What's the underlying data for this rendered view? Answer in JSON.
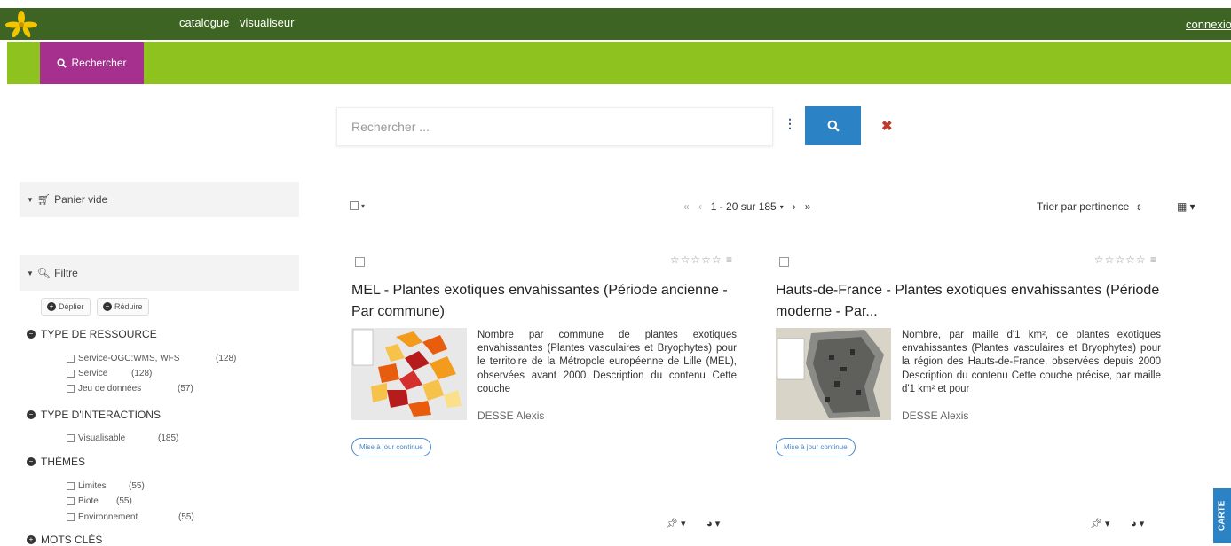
{
  "nav": {
    "items": [
      "catalogue",
      "visualiseur"
    ],
    "connexion": "connexion"
  },
  "subnav": {
    "rechercher": "Rechercher"
  },
  "search": {
    "placeholder": "Rechercher ..."
  },
  "sidebar": {
    "panier": "Panier vide",
    "filtre": "Filtre",
    "deplier": "Déplier",
    "reduire": "Réduire",
    "facets": [
      {
        "title": "TYPE DE RESSOURCE",
        "items": [
          {
            "label": "Service-OGC:WMS, WFS",
            "count": "(128)"
          },
          {
            "label": "Service",
            "count": "(128)"
          },
          {
            "label": "Jeu de données",
            "count": "(57)"
          }
        ]
      },
      {
        "title": "TYPE D'INTERACTIONS",
        "items": [
          {
            "label": "Visualisable",
            "count": "(185)"
          }
        ]
      },
      {
        "title": "THÈMES",
        "items": [
          {
            "label": "Limites",
            "count": "(55)"
          },
          {
            "label": "Biote",
            "count": "(55)"
          },
          {
            "label": "Environnement",
            "count": "(55)"
          }
        ]
      },
      {
        "title": "MOTS CLÉS",
        "items": []
      }
    ]
  },
  "results": {
    "pager_text": "1 - 20 sur 185",
    "sort_label": "Trier par pertinence",
    "cards": [
      {
        "title": "MEL - Plantes exotiques envahissantes (Période ancienne - Par commune)",
        "description": "Nombre par commune de plantes exotiques envahissantes (Plantes vasculaires et Bryophytes) pour le territoire de la Métropole européenne de Lille (MEL), observées avant 2000 Description du contenu Cette couche",
        "author": "DESSE Alexis",
        "badge": "Mise à jour continue"
      },
      {
        "title": "Hauts-de-France - Plantes exotiques envahissantes (Période moderne - Par...",
        "description": "Nombre, par maille d'1 km², de plantes exotiques envahissantes (Plantes vasculaires et Bryophytes) pour la région des Hauts-de-France, observées depuis 2000 Description du contenu Cette couche précise, par maille d'1 km² et pour",
        "author": "DESSE Alexis",
        "badge": "Mise à jour continue"
      }
    ]
  },
  "carte_tab": "CARTE",
  "colors": {
    "dark_green": "#3d6423",
    "lime": "#8dc21f",
    "magenta": "#a6308e",
    "blue": "#2b82c4"
  }
}
